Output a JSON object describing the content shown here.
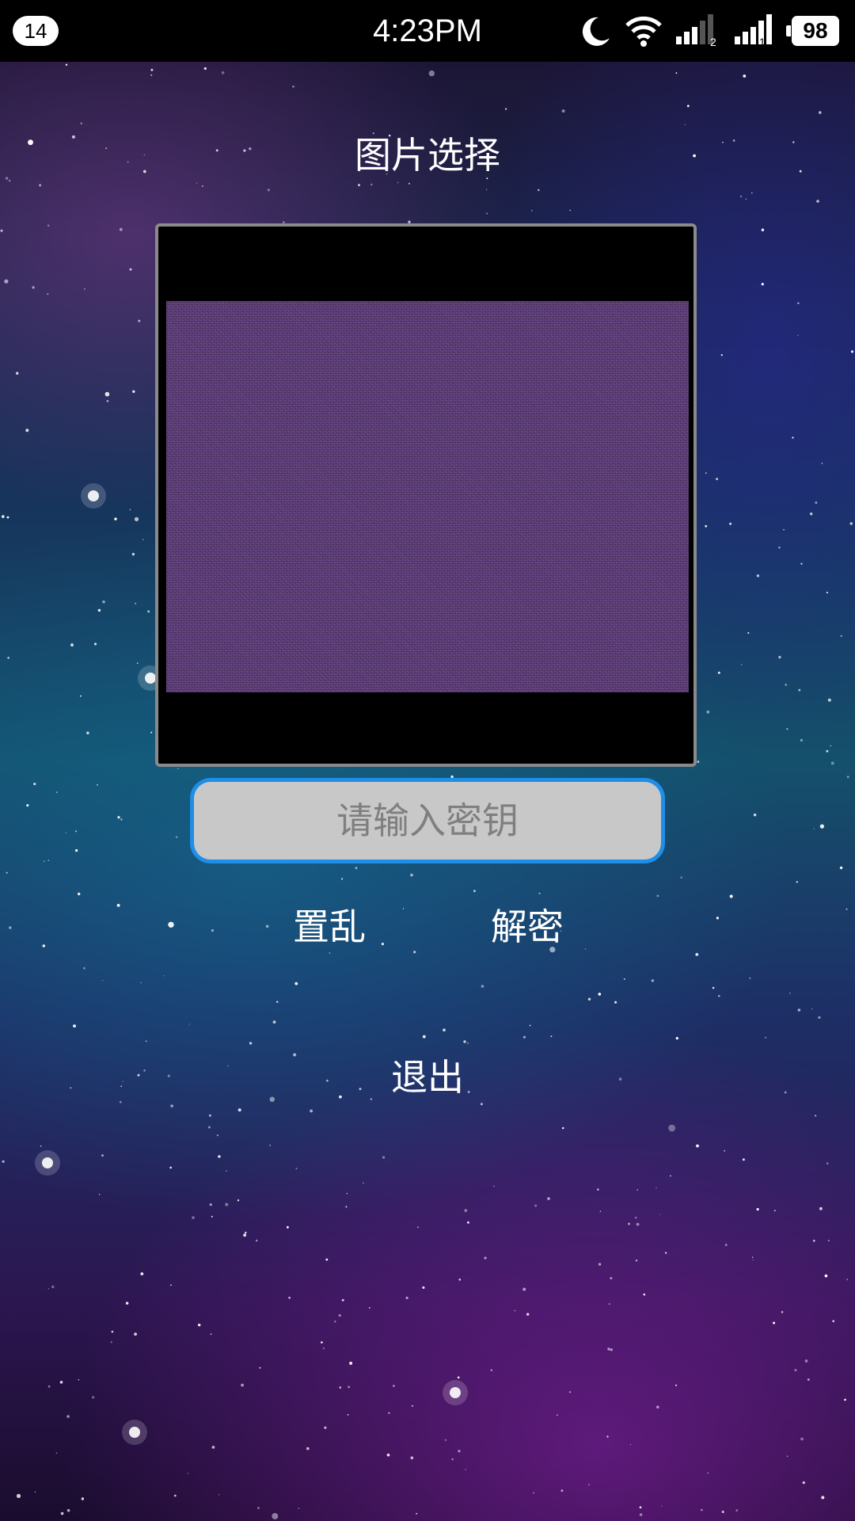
{
  "status_bar": {
    "notification_count": "14",
    "time": "4:23PM",
    "icons": [
      "moon-icon",
      "wifi-icon",
      "signal-sim2-icon",
      "signal-sim1-icon"
    ],
    "sim2_label": "2",
    "sim1_label": "1",
    "battery": "98"
  },
  "page": {
    "title": "图片选择",
    "key_input": {
      "value": "",
      "placeholder": "请输入密钥"
    },
    "buttons": {
      "scramble": "置乱",
      "decrypt": "解密",
      "exit": "退出"
    }
  },
  "colors": {
    "input_border": "#1e8ee6",
    "input_background": "#c8c8c8",
    "image_tint": "#5d3d78"
  }
}
